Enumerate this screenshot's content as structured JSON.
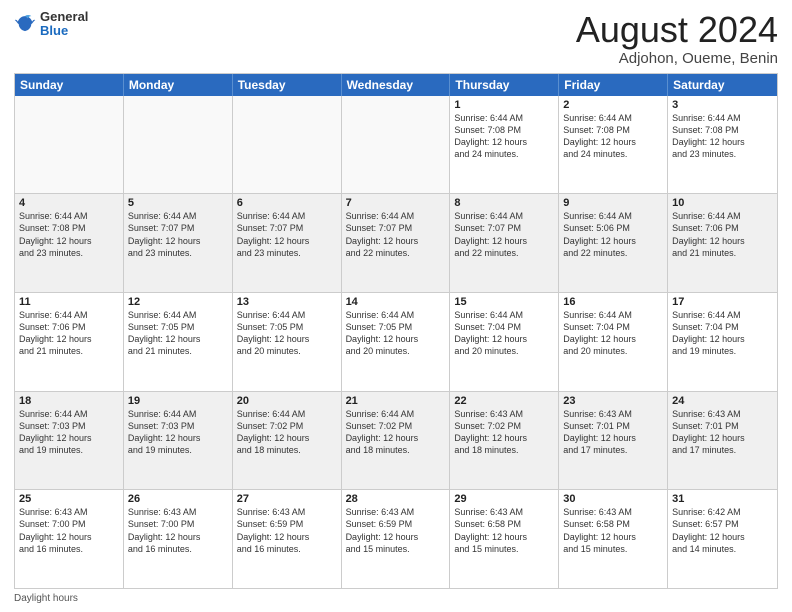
{
  "header": {
    "logo": {
      "general": "General",
      "blue": "Blue"
    },
    "title": "August 2024",
    "subtitle": "Adjohon, Oueme, Benin"
  },
  "calendar": {
    "days_of_week": [
      "Sunday",
      "Monday",
      "Tuesday",
      "Wednesday",
      "Thursday",
      "Friday",
      "Saturday"
    ],
    "rows": [
      [
        {
          "day": "",
          "detail": "",
          "empty": true
        },
        {
          "day": "",
          "detail": "",
          "empty": true
        },
        {
          "day": "",
          "detail": "",
          "empty": true
        },
        {
          "day": "",
          "detail": "",
          "empty": true
        },
        {
          "day": "1",
          "detail": "Sunrise: 6:44 AM\nSunset: 7:08 PM\nDaylight: 12 hours\nand 24 minutes.",
          "empty": false
        },
        {
          "day": "2",
          "detail": "Sunrise: 6:44 AM\nSunset: 7:08 PM\nDaylight: 12 hours\nand 24 minutes.",
          "empty": false
        },
        {
          "day": "3",
          "detail": "Sunrise: 6:44 AM\nSunset: 7:08 PM\nDaylight: 12 hours\nand 23 minutes.",
          "empty": false
        }
      ],
      [
        {
          "day": "4",
          "detail": "Sunrise: 6:44 AM\nSunset: 7:08 PM\nDaylight: 12 hours\nand 23 minutes.",
          "empty": false
        },
        {
          "day": "5",
          "detail": "Sunrise: 6:44 AM\nSunset: 7:07 PM\nDaylight: 12 hours\nand 23 minutes.",
          "empty": false
        },
        {
          "day": "6",
          "detail": "Sunrise: 6:44 AM\nSunset: 7:07 PM\nDaylight: 12 hours\nand 23 minutes.",
          "empty": false
        },
        {
          "day": "7",
          "detail": "Sunrise: 6:44 AM\nSunset: 7:07 PM\nDaylight: 12 hours\nand 22 minutes.",
          "empty": false
        },
        {
          "day": "8",
          "detail": "Sunrise: 6:44 AM\nSunset: 7:07 PM\nDaylight: 12 hours\nand 22 minutes.",
          "empty": false
        },
        {
          "day": "9",
          "detail": "Sunrise: 6:44 AM\nSunset: 5:06 PM\nDaylight: 12 hours\nand 22 minutes.",
          "empty": false
        },
        {
          "day": "10",
          "detail": "Sunrise: 6:44 AM\nSunset: 7:06 PM\nDaylight: 12 hours\nand 21 minutes.",
          "empty": false
        }
      ],
      [
        {
          "day": "11",
          "detail": "Sunrise: 6:44 AM\nSunset: 7:06 PM\nDaylight: 12 hours\nand 21 minutes.",
          "empty": false
        },
        {
          "day": "12",
          "detail": "Sunrise: 6:44 AM\nSunset: 7:05 PM\nDaylight: 12 hours\nand 21 minutes.",
          "empty": false
        },
        {
          "day": "13",
          "detail": "Sunrise: 6:44 AM\nSunset: 7:05 PM\nDaylight: 12 hours\nand 20 minutes.",
          "empty": false
        },
        {
          "day": "14",
          "detail": "Sunrise: 6:44 AM\nSunset: 7:05 PM\nDaylight: 12 hours\nand 20 minutes.",
          "empty": false
        },
        {
          "day": "15",
          "detail": "Sunrise: 6:44 AM\nSunset: 7:04 PM\nDaylight: 12 hours\nand 20 minutes.",
          "empty": false
        },
        {
          "day": "16",
          "detail": "Sunrise: 6:44 AM\nSunset: 7:04 PM\nDaylight: 12 hours\nand 20 minutes.",
          "empty": false
        },
        {
          "day": "17",
          "detail": "Sunrise: 6:44 AM\nSunset: 7:04 PM\nDaylight: 12 hours\nand 19 minutes.",
          "empty": false
        }
      ],
      [
        {
          "day": "18",
          "detail": "Sunrise: 6:44 AM\nSunset: 7:03 PM\nDaylight: 12 hours\nand 19 minutes.",
          "empty": false
        },
        {
          "day": "19",
          "detail": "Sunrise: 6:44 AM\nSunset: 7:03 PM\nDaylight: 12 hours\nand 19 minutes.",
          "empty": false
        },
        {
          "day": "20",
          "detail": "Sunrise: 6:44 AM\nSunset: 7:02 PM\nDaylight: 12 hours\nand 18 minutes.",
          "empty": false
        },
        {
          "day": "21",
          "detail": "Sunrise: 6:44 AM\nSunset: 7:02 PM\nDaylight: 12 hours\nand 18 minutes.",
          "empty": false
        },
        {
          "day": "22",
          "detail": "Sunrise: 6:43 AM\nSunset: 7:02 PM\nDaylight: 12 hours\nand 18 minutes.",
          "empty": false
        },
        {
          "day": "23",
          "detail": "Sunrise: 6:43 AM\nSunset: 7:01 PM\nDaylight: 12 hours\nand 17 minutes.",
          "empty": false
        },
        {
          "day": "24",
          "detail": "Sunrise: 6:43 AM\nSunset: 7:01 PM\nDaylight: 12 hours\nand 17 minutes.",
          "empty": false
        }
      ],
      [
        {
          "day": "25",
          "detail": "Sunrise: 6:43 AM\nSunset: 7:00 PM\nDaylight: 12 hours\nand 16 minutes.",
          "empty": false
        },
        {
          "day": "26",
          "detail": "Sunrise: 6:43 AM\nSunset: 7:00 PM\nDaylight: 12 hours\nand 16 minutes.",
          "empty": false
        },
        {
          "day": "27",
          "detail": "Sunrise: 6:43 AM\nSunset: 6:59 PM\nDaylight: 12 hours\nand 16 minutes.",
          "empty": false
        },
        {
          "day": "28",
          "detail": "Sunrise: 6:43 AM\nSunset: 6:59 PM\nDaylight: 12 hours\nand 15 minutes.",
          "empty": false
        },
        {
          "day": "29",
          "detail": "Sunrise: 6:43 AM\nSunset: 6:58 PM\nDaylight: 12 hours\nand 15 minutes.",
          "empty": false
        },
        {
          "day": "30",
          "detail": "Sunrise: 6:43 AM\nSunset: 6:58 PM\nDaylight: 12 hours\nand 15 minutes.",
          "empty": false
        },
        {
          "day": "31",
          "detail": "Sunrise: 6:42 AM\nSunset: 6:57 PM\nDaylight: 12 hours\nand 14 minutes.",
          "empty": false
        }
      ]
    ]
  },
  "footer": {
    "note": "Daylight hours"
  }
}
